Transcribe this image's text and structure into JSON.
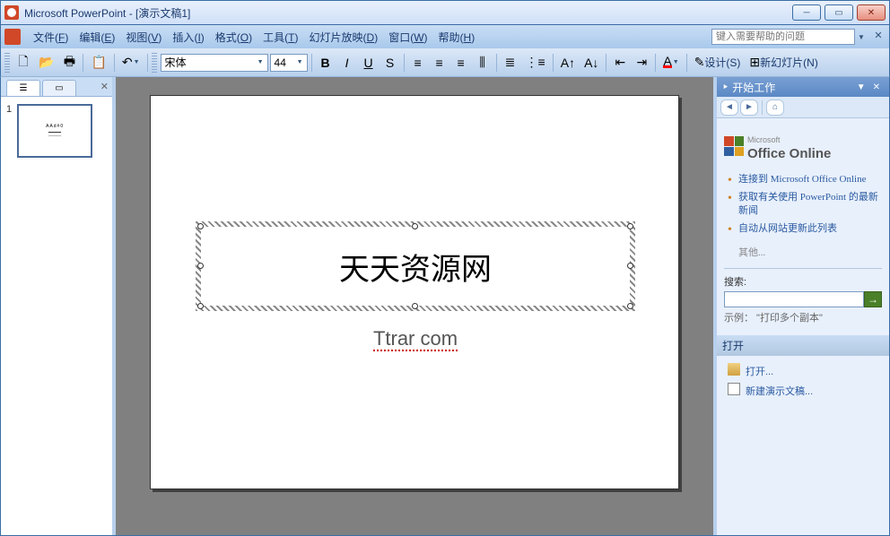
{
  "titlebar": {
    "app_name": "Microsoft PowerPoint",
    "doc_name": "[演示文稿1]"
  },
  "menubar": {
    "items": [
      {
        "label": "文件",
        "key": "F"
      },
      {
        "label": "编辑",
        "key": "E"
      },
      {
        "label": "视图",
        "key": "V"
      },
      {
        "label": "插入",
        "key": "I"
      },
      {
        "label": "格式",
        "key": "O"
      },
      {
        "label": "工具",
        "key": "T"
      },
      {
        "label": "幻灯片放映",
        "key": "D"
      },
      {
        "label": "窗口",
        "key": "W"
      },
      {
        "label": "帮助",
        "key": "H"
      }
    ],
    "help_placeholder": "键入需要帮助的问题"
  },
  "toolbar": {
    "font_name": "宋体",
    "font_size": "44",
    "design_label": "设计(S)",
    "new_slide_label": "新幻灯片(N)"
  },
  "outline": {
    "slide_number": "1"
  },
  "slide": {
    "title_text": "天天资源网",
    "subtitle_text": "Ttrar com"
  },
  "task_pane": {
    "title": "开始工作",
    "office_online": "Office Online",
    "office_prefix": "Microsoft",
    "links": [
      "连接到 Microsoft Office Online",
      "获取有关使用 PowerPoint 的最新新闻",
      "自动从网站更新此列表"
    ],
    "other_label": "其他...",
    "search_label": "搜索:",
    "example_text": "示例： \"打印多个副本\"",
    "open_header": "打开",
    "open_items": [
      "打开...",
      "新建演示文稿..."
    ]
  }
}
